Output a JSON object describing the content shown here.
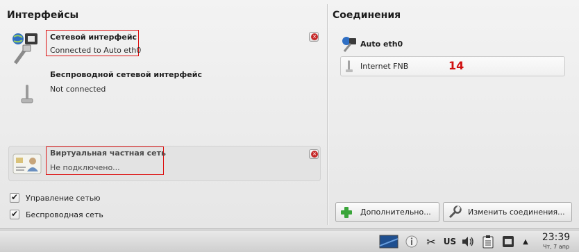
{
  "interfaces": {
    "title": "Интерфейсы",
    "wired": {
      "name": "Сетевой интерфейс",
      "status": "Connected to Auto eth0"
    },
    "wireless": {
      "name": "Беспроводной сетевой интерфейс",
      "status": "Not connected"
    },
    "vpn": {
      "name": "Виртуальная частная сеть",
      "status": "Не подключено..."
    },
    "options": [
      {
        "label": "Управление сетью",
        "checked": true
      },
      {
        "label": "Беспроводная сеть",
        "checked": true
      }
    ]
  },
  "connections": {
    "title": "Соединения",
    "active": "Auto eth0",
    "list": [
      {
        "label": "Internet FNB"
      }
    ],
    "badge": "14",
    "badge_color": "#d01010",
    "buttons": {
      "more": "Дополнительно...",
      "edit": "Изменить соединения..."
    }
  },
  "taskbar": {
    "keyboard_layout": "US",
    "time": "23:39",
    "date": "Чт, 7 апр"
  },
  "icons": [
    "network-wired-icon",
    "network-wireless-icon",
    "vpn-card-icon",
    "close-icon",
    "add-icon",
    "wrench-icon",
    "info-icon",
    "scissors-icon",
    "volume-icon",
    "clipboard-icon",
    "network-tray-icon",
    "arrow-up-icon",
    "desktop-icon"
  ]
}
